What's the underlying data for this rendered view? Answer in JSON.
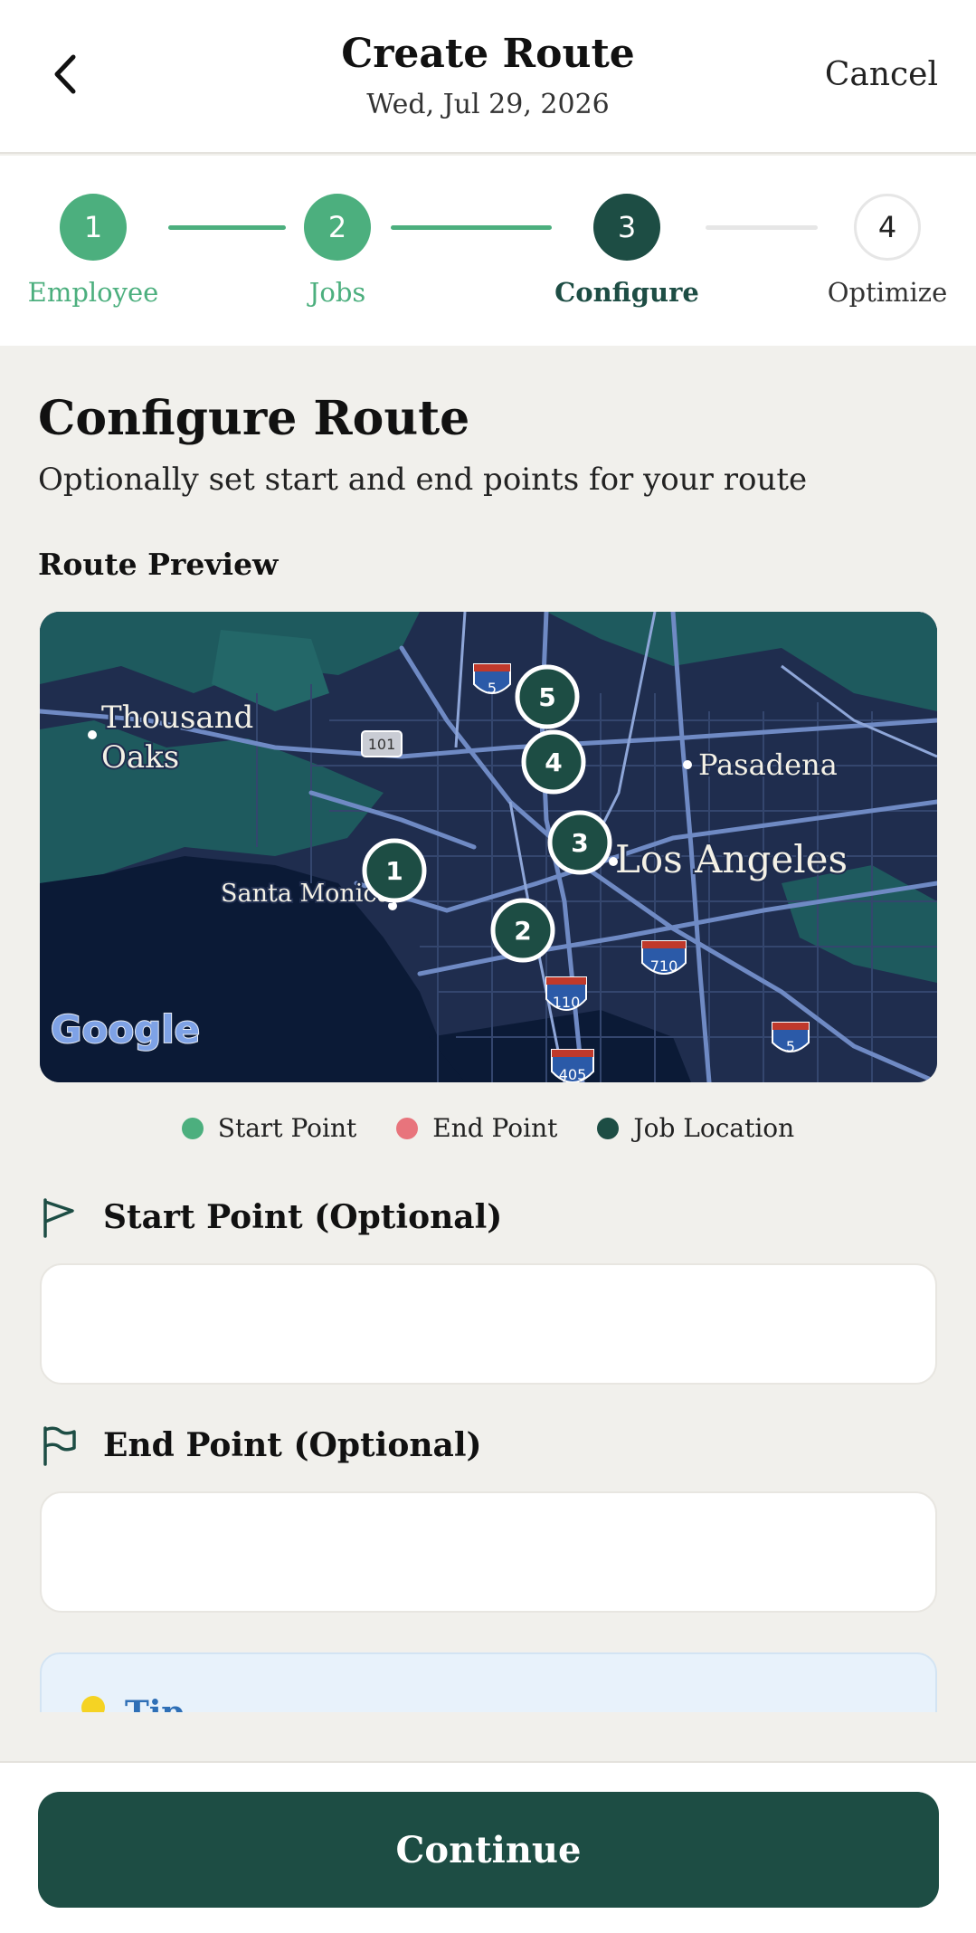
{
  "header": {
    "title": "Create Route",
    "date": "Wed, Jul 29, 2026",
    "cancel_label": "Cancel"
  },
  "stepper": {
    "steps": [
      {
        "number": "1",
        "label": "Employee",
        "state": "done"
      },
      {
        "number": "2",
        "label": "Jobs",
        "state": "done"
      },
      {
        "number": "3",
        "label": "Configure",
        "state": "active"
      },
      {
        "number": "4",
        "label": "Optimize",
        "state": "todo"
      }
    ]
  },
  "main": {
    "title": "Configure Route",
    "description": "Optionally set start and end points for your route",
    "preview_label": "Route Preview"
  },
  "map": {
    "place_labels": {
      "thousand": "Thousand",
      "oaks": "Oaks",
      "pasadena": "Pasadena",
      "los_angeles": "Los Angeles",
      "santa_monica": "Santa Monica"
    },
    "highway_shields": {
      "i5_north": "5",
      "us101": "101",
      "i110": "110",
      "i710": "710",
      "i405": "405",
      "i5_south": "5"
    },
    "markers": [
      "1",
      "2",
      "3",
      "4",
      "5"
    ],
    "provider_logo": "Google"
  },
  "legend": {
    "start": {
      "label": "Start Point",
      "color": "#4caf7e"
    },
    "end": {
      "label": "End Point",
      "color": "#e8747c"
    },
    "job": {
      "label": "Job Location",
      "color": "#1d4d44"
    }
  },
  "start_field": {
    "label": "Start Point (Optional)",
    "value": ""
  },
  "end_field": {
    "label": "End Point (Optional)",
    "value": ""
  },
  "tip": {
    "title": "Tip"
  },
  "footer": {
    "continue_label": "Continue"
  },
  "colors": {
    "primary": "#1d4d44",
    "accent": "#4caf7e",
    "background": "#f1f0ec"
  }
}
